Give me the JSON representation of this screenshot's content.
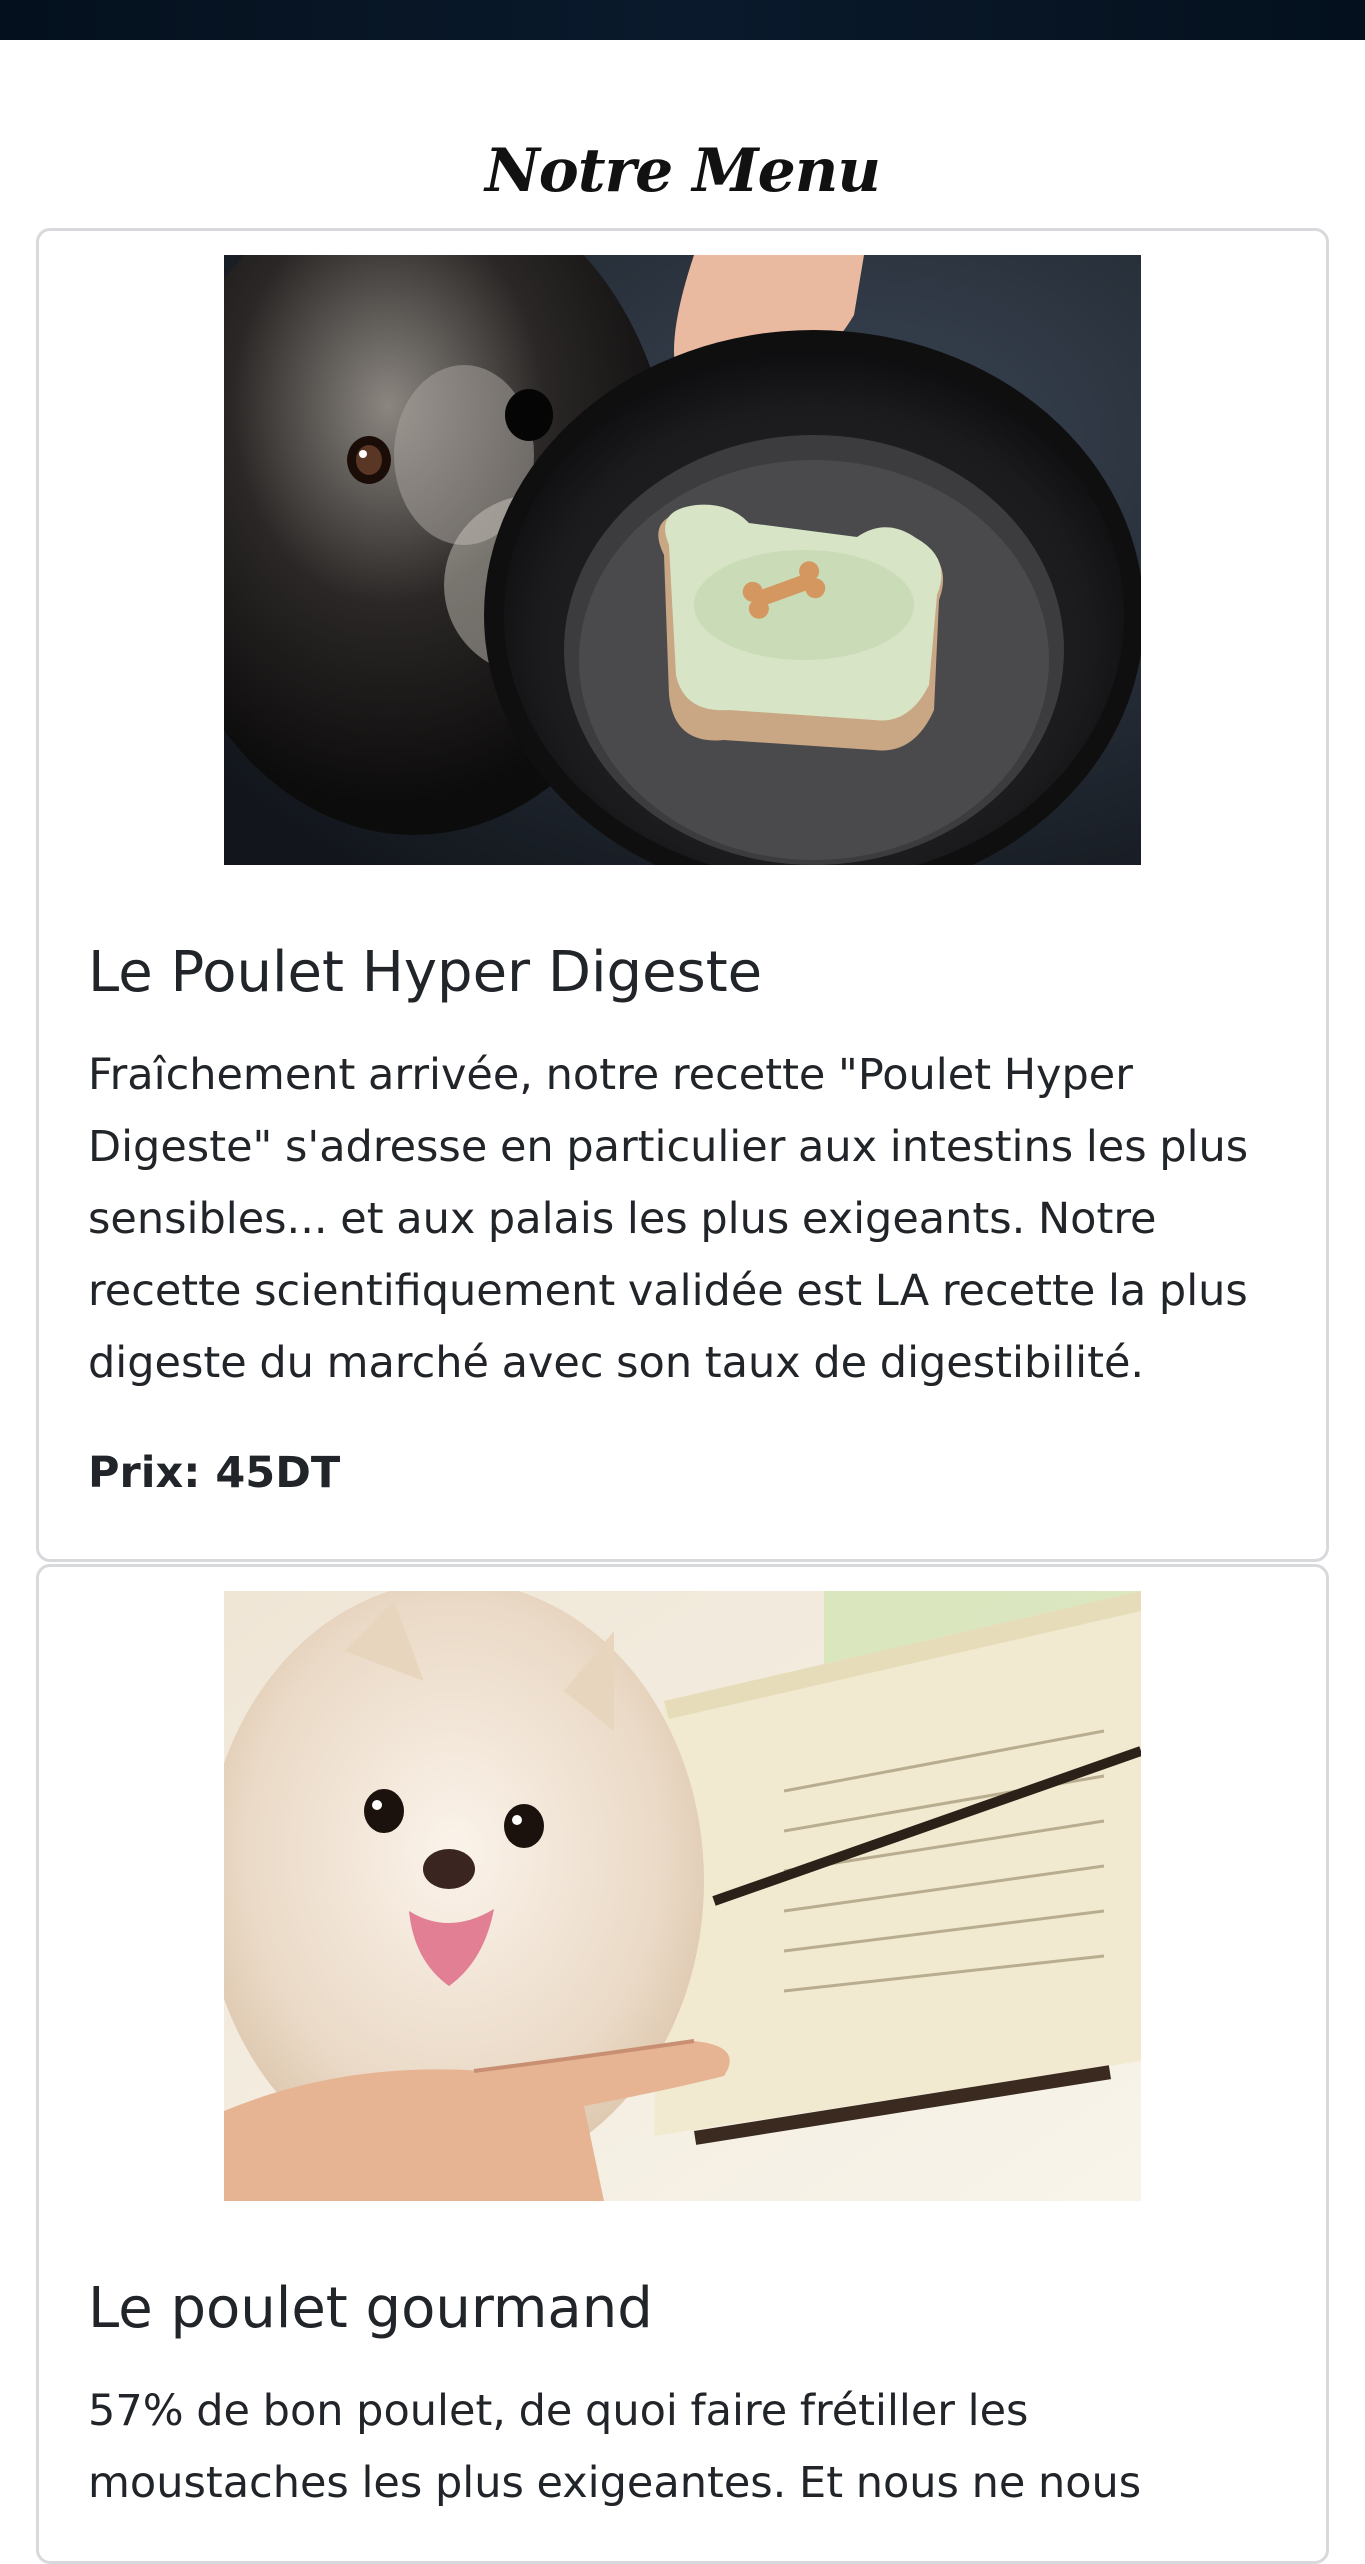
{
  "page": {
    "title": "Notre Menu"
  },
  "items": [
    {
      "name": "Le Poulet Hyper Digeste",
      "description": "Fraîchement arrivée, notre recette \"Poulet Hyper Digeste\" s'adresse en particulier aux intestins les plus sensibles... et aux palais les plus exigeants. Notre recette scientifiquement validée est LA recette la plus digeste du marché avec son taux de digestibilité.",
      "price_label": "Prix:",
      "price_value": "45DT"
    },
    {
      "name": "Le poulet gourmand",
      "description": "57% de bon poulet, de quoi faire frétiller les moustaches les plus exigeantes. Et nous ne nous"
    }
  ],
  "colors": {
    "topbar": "#04101d",
    "card_border": "#d7d9dc",
    "text": "#212529"
  }
}
